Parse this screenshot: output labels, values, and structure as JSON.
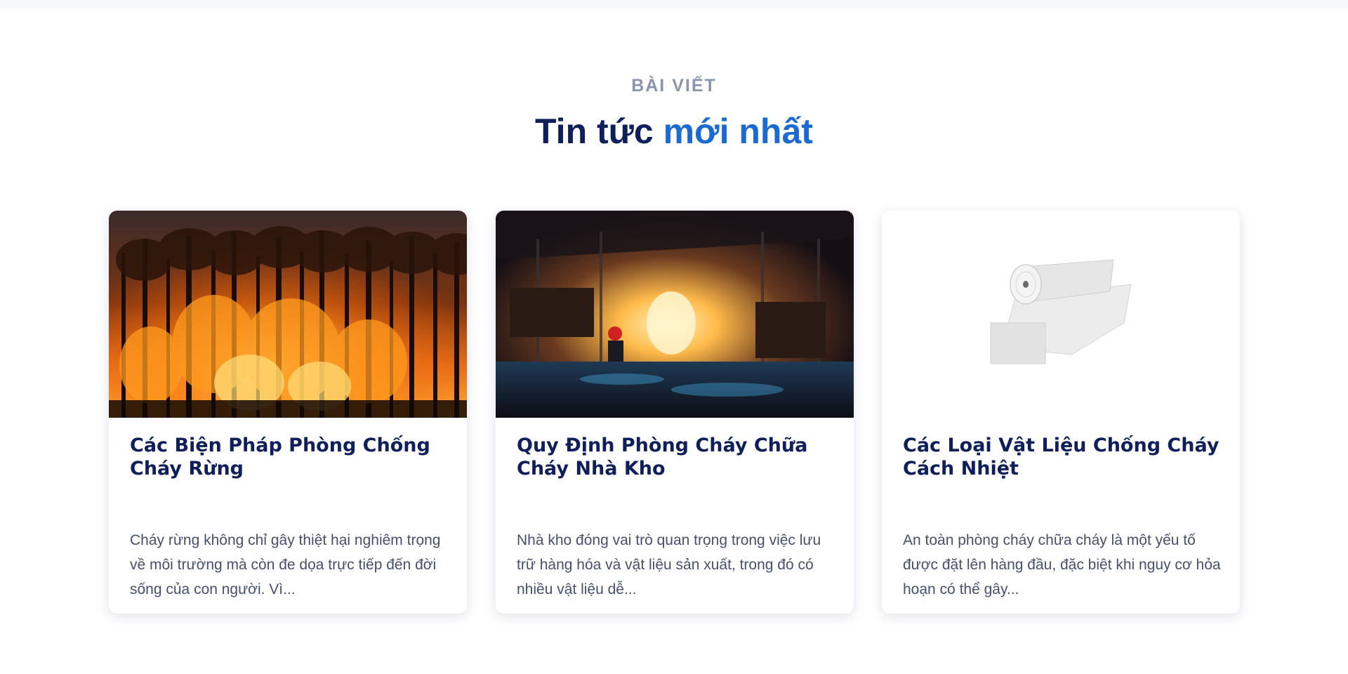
{
  "section": {
    "eyebrow": "BÀI VIẾT",
    "title_main": "Tin tức",
    "title_accent": "mới nhất"
  },
  "posts": [
    {
      "title": "Các Biện Pháp Phòng Chống Cháy Rừng",
      "excerpt": "Cháy rừng không chỉ gây thiệt hại nghiêm trọng về môi trường mà còn đe dọa trực tiếp đến đời sống của con người. Vì...",
      "image": "forest-fire-photo"
    },
    {
      "title": "Quy Định Phòng Cháy Chữa Cháy Nhà Kho",
      "excerpt": "Nhà kho đóng vai trò quan trọng trong việc lưu trữ hàng hóa và vật liệu sản xuất, trong đó có nhiều vật liệu dễ...",
      "image": "warehouse-fire-photo"
    },
    {
      "title": "Các Loại Vật Liệu Chống Cháy Cách Nhiệt",
      "excerpt": "An toàn phòng cháy chữa cháy là một yếu tố được đặt lên hàng đầu, đặc biệt khi nguy cơ hỏa hoạn có thể gây...",
      "image": "insulation-roll-photo"
    }
  ],
  "colors": {
    "eyebrow": "#8a94ad",
    "title_dark": "#0f1f5c",
    "title_accent": "#1a6ad2",
    "text": "#46506d"
  }
}
